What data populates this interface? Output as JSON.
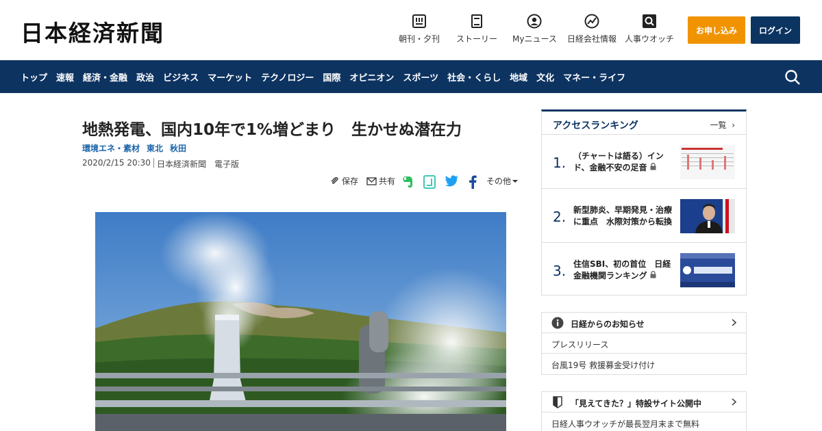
{
  "header": {
    "logo": "日本経済新聞",
    "nav": [
      {
        "label": "朝刊・夕刊",
        "icon": "newspaper-icon"
      },
      {
        "label": "ストーリー",
        "icon": "book-icon"
      },
      {
        "label": "Myニュース",
        "icon": "user-icon"
      },
      {
        "label": "日経会社情報",
        "icon": "chart-icon"
      },
      {
        "label": "人事ウオッチ",
        "icon": "magnifier-icon"
      }
    ],
    "subscribe_label": "お申し込み",
    "login_label": "ログイン"
  },
  "categories": [
    "トップ",
    "速報",
    "経済・金融",
    "政治",
    "ビジネス",
    "マーケット",
    "テクノロジー",
    "国際",
    "オピニオン",
    "スポーツ",
    "社会・くらし",
    "地域",
    "文化",
    "マネー・ライフ"
  ],
  "article": {
    "title": "地熱発電、国内10年で1%増どまり　生かせぬ潜在力",
    "tags": [
      "環境エネ・素材",
      "東北",
      "秋田"
    ],
    "date": "2020/2/15 20:30",
    "source": "日本経済新聞　電子版",
    "share": {
      "save": "保存",
      "share": "共有",
      "other": "その他"
    }
  },
  "ranking": {
    "title": "アクセスランキング",
    "more": "一覧",
    "items": [
      {
        "num": "1.",
        "text": "（チャートは語る）インド、金融不安の足音",
        "locked": true
      },
      {
        "num": "2.",
        "text": "新型肺炎、早期発見・治療に重点　水際対策から転換",
        "locked": false
      },
      {
        "num": "3.",
        "text": "住信SBI、初の首位　日経金融機関ランキング",
        "locked": true
      }
    ]
  },
  "notice": {
    "title": "日経からのお知らせ",
    "items": [
      "プレスリリース",
      "台風19号 救援募金受け付け"
    ]
  },
  "feature": {
    "title": "「見えてきた？」特設サイト公開中",
    "items": [
      "日経人事ウオッチが最長翌月末まで無料"
    ]
  },
  "colors": {
    "navy": "#0d3361",
    "orange": "#f19300",
    "tag_blue": "#1a63a8"
  }
}
